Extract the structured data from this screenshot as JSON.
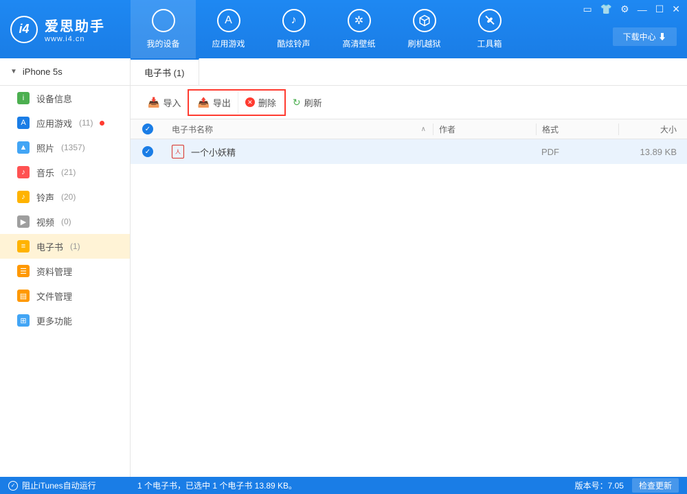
{
  "logo": {
    "icon": "i4",
    "cn": "爱思助手",
    "en": "www.i4.cn"
  },
  "nav": [
    {
      "label": "我的设备",
      "icon": ""
    },
    {
      "label": "应用游戏",
      "icon": "A"
    },
    {
      "label": "酷炫铃声",
      "icon": "♪"
    },
    {
      "label": "高清壁纸",
      "icon": "✲"
    },
    {
      "label": "刷机越狱",
      "icon": "�что"
    },
    {
      "label": "工具箱",
      "icon": "✕"
    }
  ],
  "download_center": "下载中心 ⬇",
  "device_name": "iPhone 5s",
  "sidebar": [
    {
      "label": "设备信息",
      "count": "",
      "color": "#4caf50",
      "glyph": "i",
      "dot": false
    },
    {
      "label": "应用游戏",
      "count": "(11)",
      "color": "#1a7de6",
      "glyph": "A",
      "dot": true
    },
    {
      "label": "照片",
      "count": "(1357)",
      "color": "#42a5f5",
      "glyph": "▲",
      "dot": false
    },
    {
      "label": "音乐",
      "count": "(21)",
      "color": "#ff5252",
      "glyph": "♪",
      "dot": false
    },
    {
      "label": "铃声",
      "count": "(20)",
      "color": "#ffb300",
      "glyph": "♪",
      "dot": false
    },
    {
      "label": "视频",
      "count": "(0)",
      "color": "#9e9e9e",
      "glyph": "▶",
      "dot": false
    },
    {
      "label": "电子书",
      "count": "(1)",
      "color": "#ffb300",
      "glyph": "≡",
      "dot": false,
      "active": true
    },
    {
      "label": "资料管理",
      "count": "",
      "color": "#ff9800",
      "glyph": "☰",
      "dot": false
    },
    {
      "label": "文件管理",
      "count": "",
      "color": "#ff9800",
      "glyph": "▤",
      "dot": false
    },
    {
      "label": "更多功能",
      "count": "",
      "color": "#42a5f5",
      "glyph": "⊞",
      "dot": false
    }
  ],
  "tab_title": "电子书 (1)",
  "toolbar": {
    "import": "导入",
    "export": "导出",
    "delete": "删除",
    "refresh": "刷新"
  },
  "columns": {
    "name": "电子书名称",
    "author": "作者",
    "format": "格式",
    "size": "大小"
  },
  "rows": [
    {
      "name": "一个小妖精",
      "author": "",
      "format": "PDF",
      "size": "13.89 KB"
    }
  ],
  "status": {
    "itunes": "阻止iTunes自动运行",
    "summary": "1 个电子书，已选中 1 个电子书 13.89 KB。",
    "version": "版本号：7.05",
    "update": "检查更新"
  }
}
